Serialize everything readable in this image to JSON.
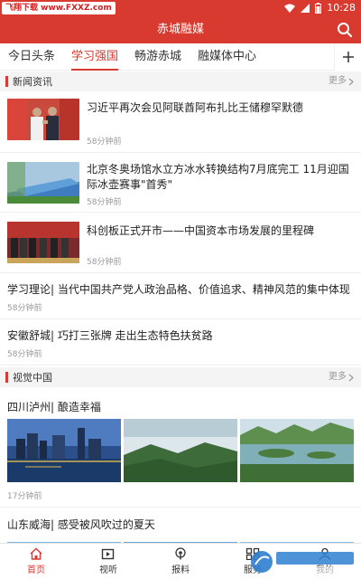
{
  "status_bar": {
    "watermark_text": "飞翔下载 www.FXXZ.com",
    "time": "10:28"
  },
  "header": {
    "title": "赤城融媒"
  },
  "tabs": [
    {
      "label": "今日头条",
      "active": false
    },
    {
      "label": "学习强国",
      "active": true
    },
    {
      "label": "畅游赤城",
      "active": false
    },
    {
      "label": "融媒体中心",
      "active": false
    }
  ],
  "sections": {
    "news": {
      "title": "新闻资讯",
      "more": "更多",
      "items": [
        {
          "title": "习近平再次会见阿联酋阿布扎比王储穆罕默德",
          "time": "58分钟前"
        },
        {
          "title": "北京冬奥场馆水立方冰水转换结构7月底完工 11月迎国际冰壶赛事\"首秀\"",
          "time": "58分钟前"
        },
        {
          "title": "科创板正式开市——中国资本市场发展的里程碑",
          "time": "58分钟前"
        },
        {
          "title": "学习理论| 当代中国共产党人政治品格、价值追求、精神风范的集中体现",
          "time": "58分钟前"
        },
        {
          "title": "安徽舒城| 巧打三张牌 走出生态特色扶贫路",
          "time": "58分钟前"
        }
      ]
    },
    "visual": {
      "title": "视觉中国",
      "more": "更多",
      "galleries": [
        {
          "title": "四川泸州| 酿造幸福",
          "time": "17分钟前"
        },
        {
          "title": "山东威海| 感受被风吹过的夏天"
        }
      ]
    }
  },
  "bottom_nav": [
    {
      "label": "首页",
      "icon": "home-icon",
      "active": true
    },
    {
      "label": "视听",
      "icon": "video-icon",
      "active": false
    },
    {
      "label": "报料",
      "icon": "broadcast-icon",
      "active": false
    },
    {
      "label": "服务",
      "icon": "service-icon",
      "active": false
    },
    {
      "label": "我的",
      "icon": "user-icon",
      "active": false
    }
  ],
  "bottom_watermark": {
    "text": "飞翔下载",
    "url": "www.FXXZ.com"
  },
  "colors": {
    "accent": "#d83a2f"
  }
}
